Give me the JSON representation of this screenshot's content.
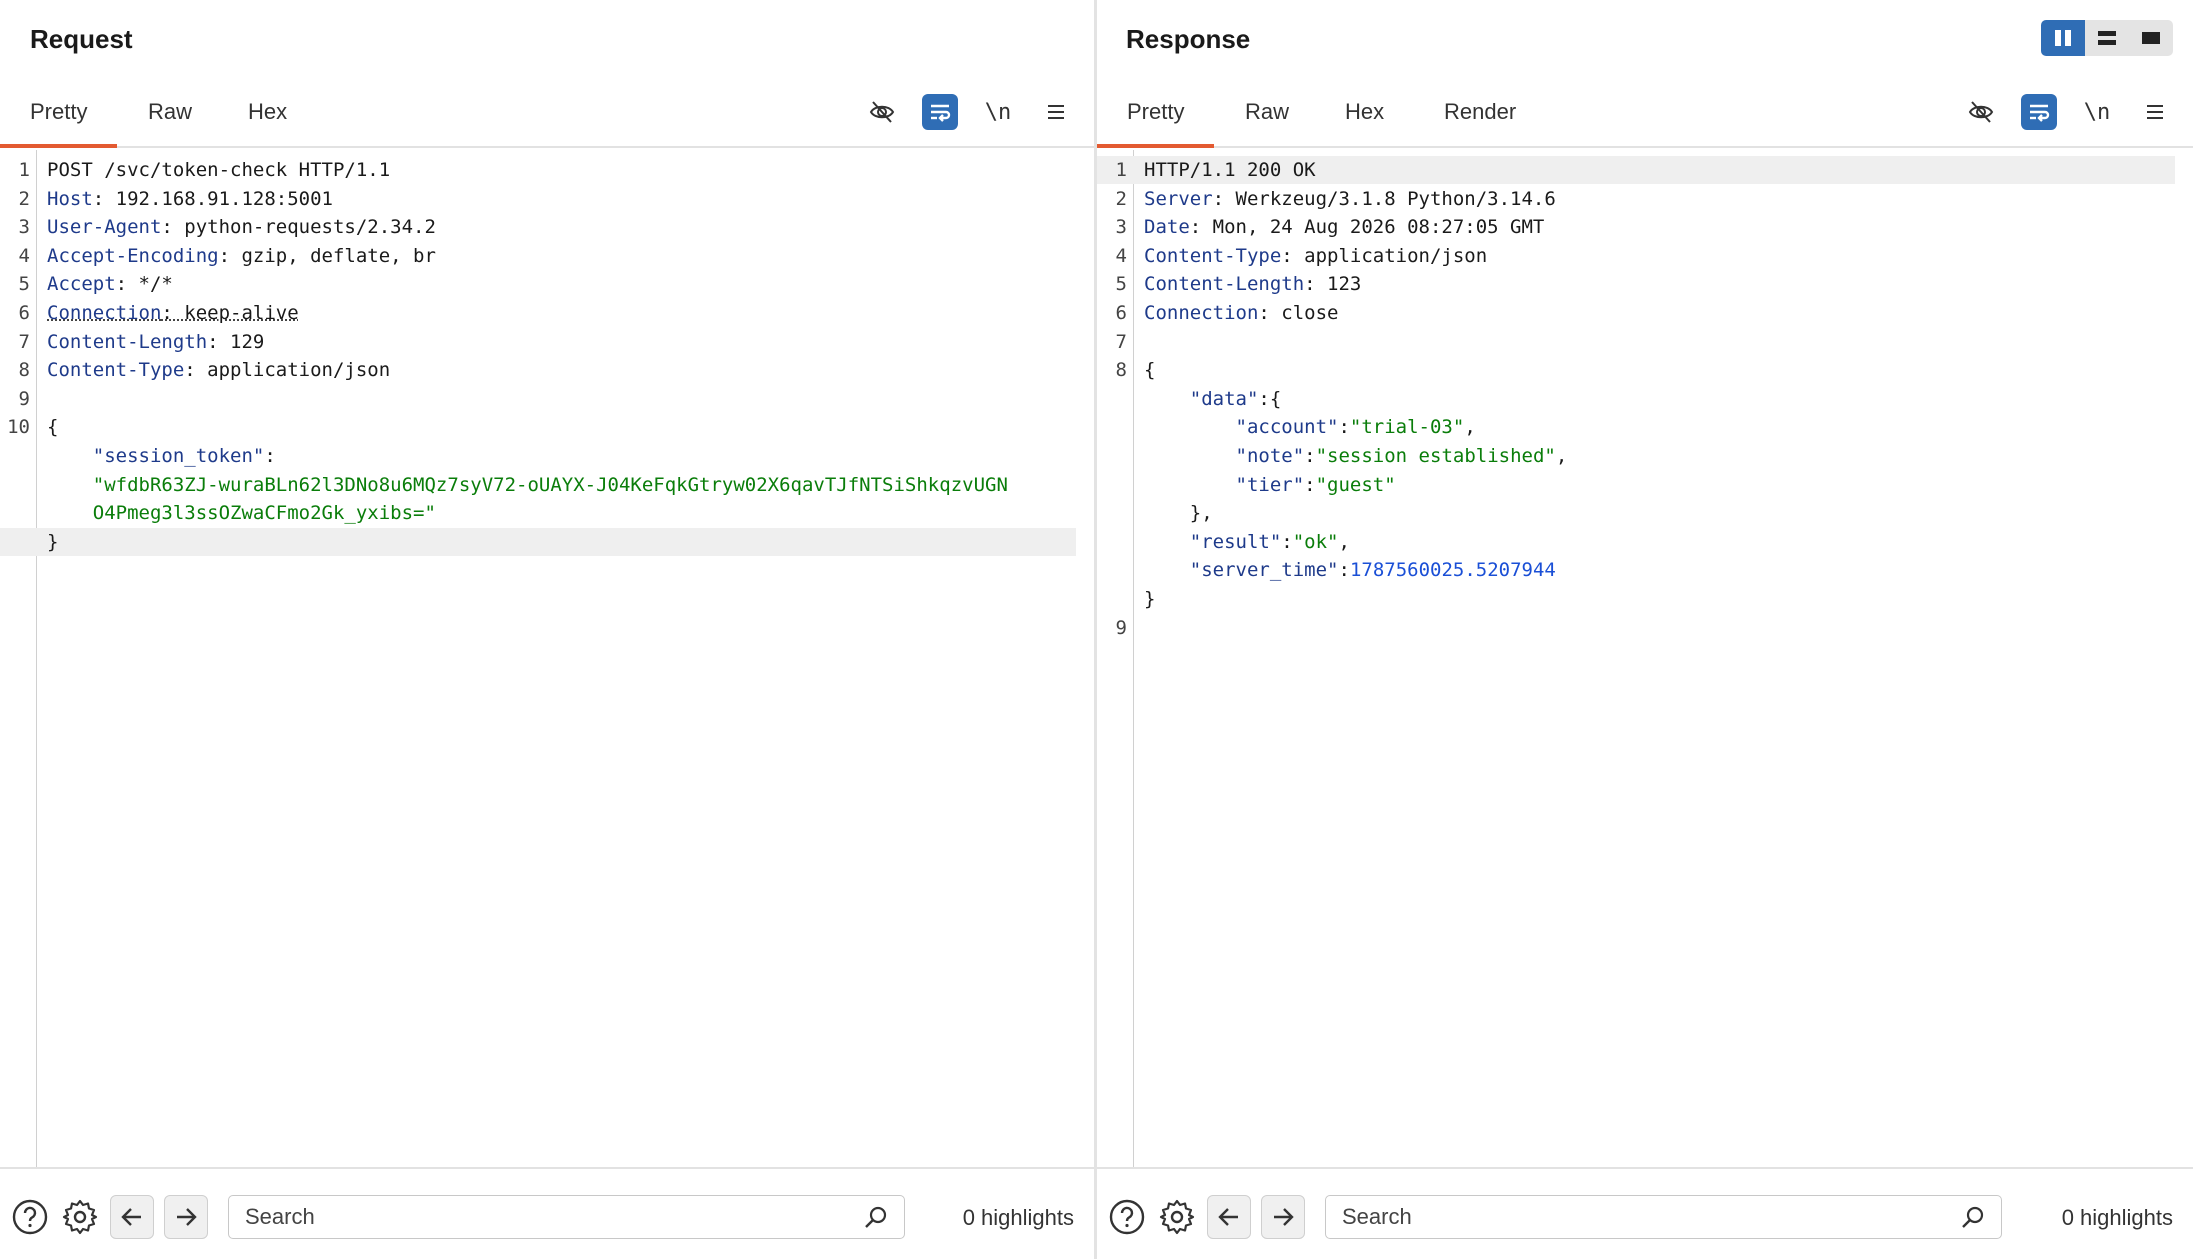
{
  "request": {
    "title": "Request",
    "tabs": [
      "Pretty",
      "Raw",
      "Hex"
    ],
    "active_tab": "Pretty",
    "newline_label": "\\n",
    "lines": [
      {
        "n": "1",
        "parts": [
          {
            "t": "POST /svc/token-check HTTP/1.1",
            "c": ""
          }
        ]
      },
      {
        "n": "2",
        "parts": [
          {
            "t": "Host",
            "c": "hk"
          },
          {
            "t": ": 192.168.91.128:5001",
            "c": ""
          }
        ]
      },
      {
        "n": "3",
        "parts": [
          {
            "t": "User-Agent",
            "c": "hk"
          },
          {
            "t": ": python-requests/2.34.2",
            "c": ""
          }
        ]
      },
      {
        "n": "4",
        "parts": [
          {
            "t": "Accept-Encoding",
            "c": "hk"
          },
          {
            "t": ": gzip, deflate, br",
            "c": ""
          }
        ]
      },
      {
        "n": "5",
        "parts": [
          {
            "t": "Accept",
            "c": "hk"
          },
          {
            "t": ": */*",
            "c": ""
          }
        ]
      },
      {
        "n": "6",
        "parts": [
          {
            "t": "Connection",
            "c": "hk ul"
          },
          {
            "t": ": keep-alive",
            "c": "ul"
          }
        ]
      },
      {
        "n": "7",
        "parts": [
          {
            "t": "Content-Length",
            "c": "hk"
          },
          {
            "t": ": 129",
            "c": ""
          }
        ]
      },
      {
        "n": "8",
        "parts": [
          {
            "t": "Content-Type",
            "c": "hk"
          },
          {
            "t": ": application/json",
            "c": ""
          }
        ]
      },
      {
        "n": "9",
        "parts": []
      },
      {
        "n": "10",
        "parts": [
          {
            "t": "{",
            "c": ""
          }
        ]
      },
      {
        "n": "",
        "parts": [
          {
            "t": "    ",
            "c": ""
          },
          {
            "t": "\"session_token\"",
            "c": "jk"
          },
          {
            "t": ":",
            "c": ""
          }
        ]
      },
      {
        "n": "",
        "parts": [
          {
            "t": "    ",
            "c": ""
          },
          {
            "t": "\"wfdbR63ZJ-wuraBLn62l3DNo8u6MQz7syV72-oUAYX-J04KeFqkGtryw02X6qavTJfNTSiShkqzvUGN",
            "c": "js"
          }
        ]
      },
      {
        "n": "",
        "parts": [
          {
            "t": "    ",
            "c": ""
          },
          {
            "t": "O4Pmeg3l3ssOZwaCFmo2Gk_yxibs=\"",
            "c": "js"
          }
        ]
      },
      {
        "n": "",
        "parts": [
          {
            "t": "}",
            "c": ""
          }
        ],
        "cursor": true
      }
    ],
    "search_placeholder": "Search",
    "highlights": "0 highlights"
  },
  "response": {
    "title": "Response",
    "tabs": [
      "Pretty",
      "Raw",
      "Hex",
      "Render"
    ],
    "active_tab": "Pretty",
    "newline_label": "\\n",
    "lines": [
      {
        "n": "1",
        "parts": [
          {
            "t": "HTTP/1.1 200 OK",
            "c": ""
          }
        ],
        "cursor": true
      },
      {
        "n": "2",
        "parts": [
          {
            "t": "Server",
            "c": "hk"
          },
          {
            "t": ": Werkzeug/3.1.8 Python/3.14.6",
            "c": ""
          }
        ]
      },
      {
        "n": "3",
        "parts": [
          {
            "t": "Date",
            "c": "hk"
          },
          {
            "t": ": Mon, 24 Aug 2026 08:27:05 GMT",
            "c": ""
          }
        ]
      },
      {
        "n": "4",
        "parts": [
          {
            "t": "Content-Type",
            "c": "hk"
          },
          {
            "t": ": application/json",
            "c": ""
          }
        ]
      },
      {
        "n": "5",
        "parts": [
          {
            "t": "Content-Length",
            "c": "hk"
          },
          {
            "t": ": 123",
            "c": ""
          }
        ]
      },
      {
        "n": "6",
        "parts": [
          {
            "t": "Connection",
            "c": "hk"
          },
          {
            "t": ": close",
            "c": ""
          }
        ]
      },
      {
        "n": "7",
        "parts": []
      },
      {
        "n": "8",
        "parts": [
          {
            "t": "{",
            "c": ""
          }
        ]
      },
      {
        "n": "",
        "parts": [
          {
            "t": "    ",
            "c": ""
          },
          {
            "t": "\"data\"",
            "c": "jk"
          },
          {
            "t": ":{",
            "c": ""
          }
        ]
      },
      {
        "n": "",
        "parts": [
          {
            "t": "        ",
            "c": ""
          },
          {
            "t": "\"account\"",
            "c": "jk"
          },
          {
            "t": ":",
            "c": ""
          },
          {
            "t": "\"trial-03\"",
            "c": "js"
          },
          {
            "t": ",",
            "c": ""
          }
        ]
      },
      {
        "n": "",
        "parts": [
          {
            "t": "        ",
            "c": ""
          },
          {
            "t": "\"note\"",
            "c": "jk"
          },
          {
            "t": ":",
            "c": ""
          },
          {
            "t": "\"session established\"",
            "c": "js"
          },
          {
            "t": ",",
            "c": ""
          }
        ]
      },
      {
        "n": "",
        "parts": [
          {
            "t": "        ",
            "c": ""
          },
          {
            "t": "\"tier\"",
            "c": "jk"
          },
          {
            "t": ":",
            "c": ""
          },
          {
            "t": "\"guest\"",
            "c": "js"
          }
        ]
      },
      {
        "n": "",
        "parts": [
          {
            "t": "    },",
            "c": ""
          }
        ]
      },
      {
        "n": "",
        "parts": [
          {
            "t": "    ",
            "c": ""
          },
          {
            "t": "\"result\"",
            "c": "jk"
          },
          {
            "t": ":",
            "c": ""
          },
          {
            "t": "\"ok\"",
            "c": "js"
          },
          {
            "t": ",",
            "c": ""
          }
        ]
      },
      {
        "n": "",
        "parts": [
          {
            "t": "    ",
            "c": ""
          },
          {
            "t": "\"server_time\"",
            "c": "jk"
          },
          {
            "t": ":",
            "c": ""
          },
          {
            "t": "1787560025.5207944",
            "c": "jn"
          }
        ]
      },
      {
        "n": "",
        "parts": [
          {
            "t": "}",
            "c": ""
          }
        ]
      },
      {
        "n": "9",
        "parts": []
      }
    ],
    "search_placeholder": "Search",
    "highlights": "0 highlights"
  },
  "icons": {
    "layout_toggle": [
      "columns-layout-icon",
      "rows-layout-icon",
      "single-pane-layout-icon"
    ],
    "toolbar": [
      "hide-eye-icon",
      "word-wrap-icon",
      "newline-toggle-icon",
      "menu-icon"
    ],
    "footer": [
      "help-icon",
      "gear-icon",
      "arrow-left-icon",
      "arrow-right-icon",
      "search-icon"
    ]
  },
  "colors": {
    "accent_tab": "#e35a31",
    "active_button": "#2f6db5",
    "header_key": "#1e3a8a",
    "json_string": "#0a7d0a",
    "json_number": "#1a4fd6"
  }
}
